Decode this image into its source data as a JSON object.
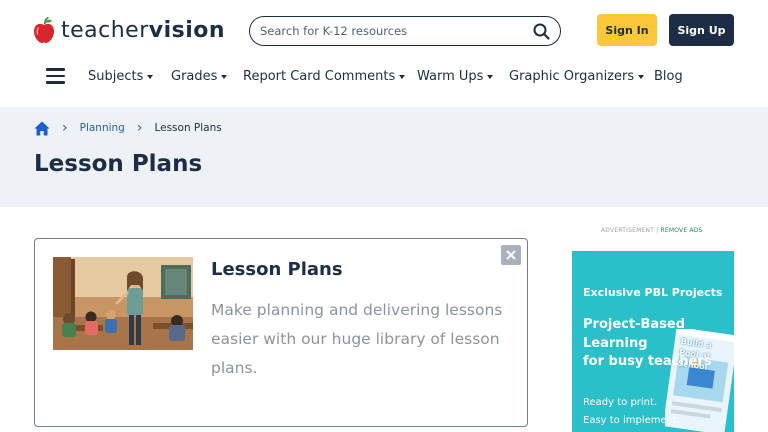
{
  "header": {
    "logo": {
      "text_light": "teacher",
      "text_bold": "vision",
      "icon": "apple-icon"
    },
    "search": {
      "placeholder": "Search for K-12 resources",
      "icon": "search-icon"
    },
    "sign_in": "Sign In",
    "sign_up": "Sign Up"
  },
  "nav": {
    "menu_icon": "hamburger-menu-icon",
    "items": [
      {
        "label": "Subjects",
        "has_dropdown": true
      },
      {
        "label": "Grades",
        "has_dropdown": true
      },
      {
        "label": "Report Card Comments",
        "has_dropdown": true
      },
      {
        "label": "Warm Ups",
        "has_dropdown": true
      },
      {
        "label": "Graphic Organizers",
        "has_dropdown": true
      },
      {
        "label": "Blog",
        "has_dropdown": false
      }
    ]
  },
  "breadcrumb": {
    "home_icon": "home-icon",
    "items": [
      "Planning",
      "Lesson Plans"
    ]
  },
  "page": {
    "title": "Lesson Plans"
  },
  "card": {
    "title": "Lesson Plans",
    "description": "Make planning and delivering lessons easier with our huge library of lesson plans.",
    "close_icon": "close-icon"
  },
  "ad": {
    "label": "ADVERTISEMENT",
    "separator": "|",
    "remove": "REMOVE ADS",
    "headline": "Exclusive PBL Projects",
    "title_lines": [
      "Project-Based",
      "Learning",
      "for busy teachers"
    ],
    "tag_lines": [
      "Ready to print.",
      "Easy to implement."
    ],
    "book_title": "Build a Pool at School"
  },
  "colors": {
    "brand_navy": "#1c2d45",
    "sign_in_yellow": "#fcc83a",
    "link_blue": "#2563a6",
    "banner_bg": "#eef1f6",
    "ad_teal": "#2bc0c9",
    "apple_red": "#d7262d"
  }
}
